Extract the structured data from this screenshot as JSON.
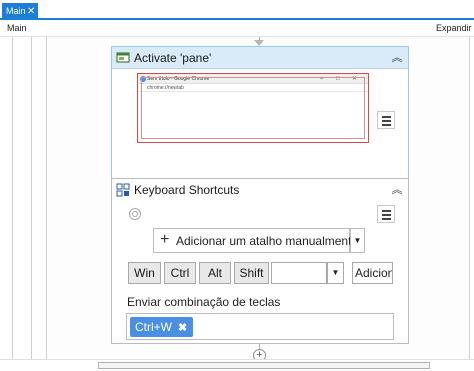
{
  "tabs": [
    {
      "label": "Main"
    }
  ],
  "breadcrumb": {
    "current": "Main"
  },
  "toolbar": {
    "expand_label": "Expandir Tu"
  },
  "activities": {
    "activate": {
      "title": "Activate 'pane'",
      "screenshot": {
        "browser_title": "Sem título - Google Chrome",
        "address": "chrome://newtab"
      }
    },
    "keyboard_shortcuts": {
      "title": "Keyboard Shortcuts",
      "add_shortcut_label": "Adicionar um atalho manualmente",
      "modifier_keys": [
        "Win",
        "Ctrl",
        "Alt",
        "Shift"
      ],
      "add_button_label": "Adicion",
      "send_combo_label": "Enviar combinação de teclas",
      "combo_chip": "Ctrl+W"
    }
  },
  "icons": {
    "close": "close-icon",
    "collapse": "chevron-up-icon",
    "menu": "menu-icon",
    "dropdown": "caret-down-icon",
    "add": "plus-circle-icon",
    "target": "target-icon"
  },
  "colors": {
    "accent": "#1c7ed6",
    "card_header": "#d9ebf8",
    "chip": "#4a90e2"
  }
}
